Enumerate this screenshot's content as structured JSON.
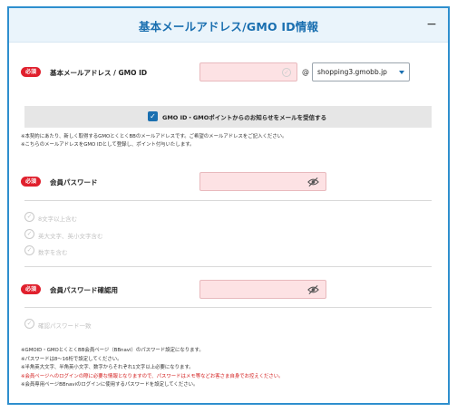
{
  "header": {
    "title": "基本メールアドレス/GMO ID情報",
    "collapse": "−"
  },
  "required_badge": "必須",
  "email": {
    "label": "基本メールアドレス / GMO ID",
    "value": "",
    "at": "@",
    "domain": "shopping3.gmobb.jp"
  },
  "consent": {
    "checked": true,
    "label": "GMO ID・GMOポイントからのお知らせをメールを受信する"
  },
  "email_notes": [
    "※本契約にあたり、新しく取得するGMOとくとくBBのメールアドレスです。ご希望のメールアドレスをご記入ください。",
    "※こちらのメールアドレスをGMO IDとして登録し、ポイント付与いたします。"
  ],
  "password": {
    "label": "会員パスワード",
    "value": "",
    "rules": [
      "8文字以上含む",
      "英大文字、英小文字含む",
      "数字を含む"
    ]
  },
  "password_confirm": {
    "label": "会員パスワード確認用",
    "value": "",
    "rules": [
      "確認パスワード一致"
    ]
  },
  "footer_notes": [
    {
      "text": "※GMOID・GMOとくとくBB会員ページ（BBnavi）のパスワード設定になります。",
      "red": false
    },
    {
      "text": "※パスワードは8～16桁で設定してください。",
      "red": false
    },
    {
      "text": "※半角英大文字、半角英小文字、数字からそれぞれ1文字以上必要になります。",
      "red": false
    },
    {
      "text": "※会員ページへのログインの際に必要な情報となりますので、パスワードはメモ等などお客さま自身でお控えください。",
      "red": true
    },
    {
      "text": "※会員専用ページBBnaviのログインに使用するパスワードを設定してください。",
      "red": false
    }
  ],
  "colors": {
    "accent": "#1a6fb0",
    "required": "#e0202d",
    "input_error_bg": "#fde2e4",
    "header_bg": "#eaf4fb"
  },
  "icons": {
    "check": "check-circle-icon",
    "eye_off": "eye-off-icon",
    "chevron": "chevron-down-icon"
  }
}
